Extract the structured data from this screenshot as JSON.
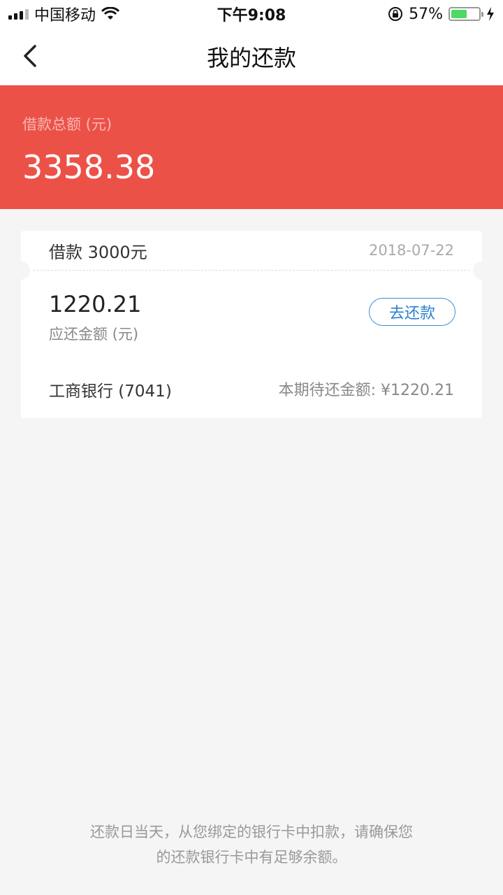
{
  "status_bar": {
    "carrier": "中国移动",
    "time": "下午9:08",
    "battery": "57%",
    "battery_level": 0.57
  },
  "nav": {
    "title": "我的还款",
    "back_icon": "chevron-left-icon"
  },
  "summary": {
    "label": "借款总额 (元)",
    "amount": "3358.38",
    "color": "#ec5148"
  },
  "loan_card": {
    "loan_text": "借款 3000元",
    "date": "2018-07-22",
    "due_amount": "1220.21",
    "due_label": "应还金额 (元)",
    "repay_button": "去还款",
    "bank": "工商银行 (7041)",
    "period_due": "本期待还金额: ¥1220.21",
    "accent_color": "#3a8fd6"
  },
  "footer": {
    "line1": "还款日当天，从您绑定的银行卡中扣款，请确保您",
    "line2": "的还款银行卡中有足够余额。"
  }
}
